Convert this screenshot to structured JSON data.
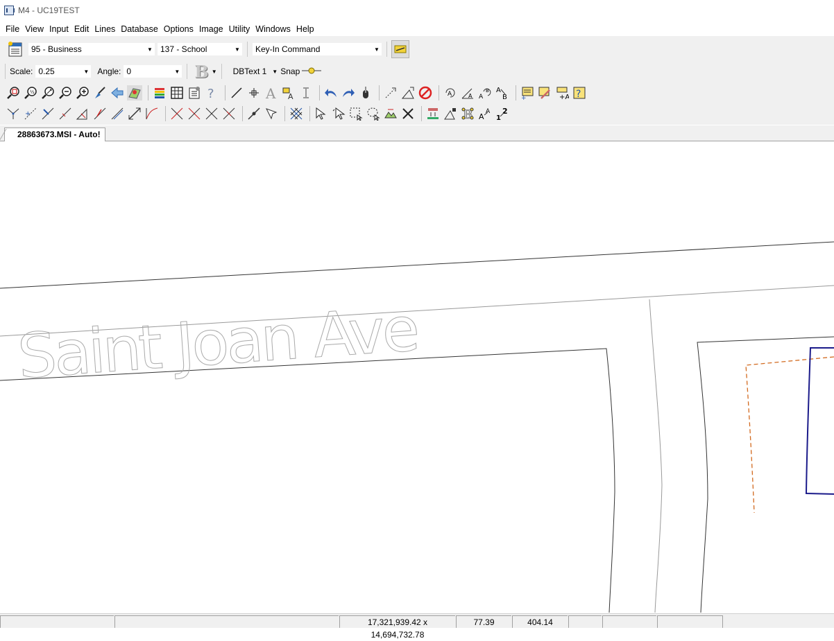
{
  "window": {
    "title": "M4 - UC19TEST"
  },
  "menu": [
    "File",
    "View",
    "Input",
    "Edit",
    "Lines",
    "Database",
    "Options",
    "Image",
    "Utility",
    "Windows",
    "Help"
  ],
  "toolbar": {
    "layer_select": "95 - Business",
    "symbol_select": "137 - School",
    "command_select": "Key-In Command",
    "scale_label": "Scale:",
    "scale_value": "0.25",
    "angle_label": "Angle:",
    "angle_value": "0",
    "bold_glyph": "B",
    "text_style": "DBText 1",
    "snap_label": "Snap"
  },
  "document_tab": "28863673.MSI - Auto!",
  "canvas": {
    "street_label": "Saint Joan Ave"
  },
  "status": {
    "coordinates": "17,321,939.42 x 14,694,732.78",
    "value1": "77.39",
    "value2": "404.14"
  }
}
